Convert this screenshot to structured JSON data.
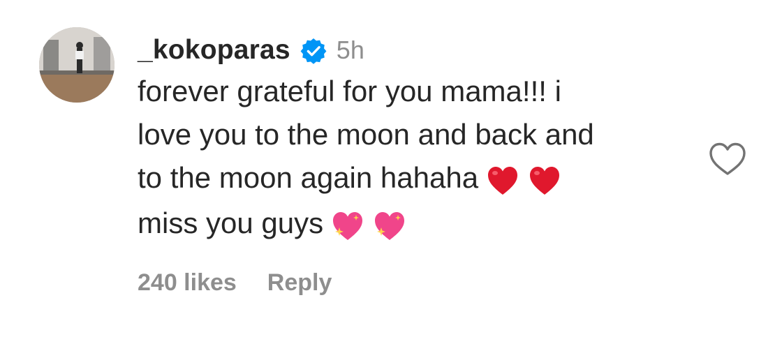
{
  "comment": {
    "username": "_kokoparas",
    "verified": true,
    "timestamp": "5h",
    "text_lines": [
      "forever grateful for you mama!!! i",
      "love you to the moon and back and",
      "to the moon again hahaha",
      "miss you guys"
    ],
    "line3_emojis": [
      "red-heart-emoji",
      "red-heart-emoji"
    ],
    "line4_emojis": [
      "sparkling-heart-emoji",
      "sparkling-heart-emoji"
    ],
    "likes_label": "240 likes",
    "reply_label": "Reply",
    "like_icon": "heart-outline-icon",
    "colors": {
      "text": "#262626",
      "secondary": "#8e8e8e",
      "verified": "#0095f6",
      "heart_red": "#e0182d",
      "sparkle_pink": "#f0458a"
    }
  }
}
